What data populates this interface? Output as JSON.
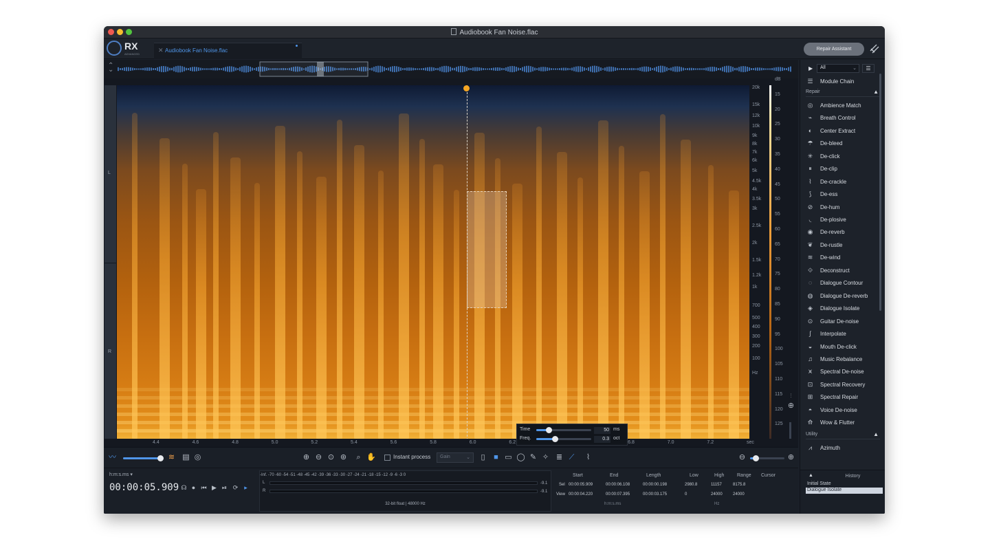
{
  "window": {
    "title": "Audiobook Fan Noise.flac"
  },
  "app": {
    "logo_text": "RX",
    "logo_sub": "ADVANCED"
  },
  "tab": {
    "name": "Audiobook Fan Noise.flac"
  },
  "header": {
    "repair_assistant": "Repair Assistant"
  },
  "spectrogram": {
    "channel_labels": [
      "L",
      "R"
    ],
    "freq_labels": [
      "20k",
      "15k",
      "12k",
      "10k",
      "9k",
      "8k",
      "7k",
      "6k",
      "5k",
      "4.5k",
      "4k",
      "3.5k",
      "3k",
      "2.5k",
      "2k",
      "1.5k",
      "1.2k",
      "1k",
      "700",
      "500",
      "400",
      "300",
      "200",
      "100",
      "Hz"
    ],
    "db_labels": [
      "dB",
      "15",
      "20",
      "25",
      "30",
      "35",
      "40",
      "45",
      "50",
      "55",
      "60",
      "65",
      "70",
      "75",
      "80",
      "85",
      "90",
      "95",
      "100",
      "105",
      "110",
      "115",
      "120",
      "125"
    ],
    "time_labels": [
      "4.4",
      "4.6",
      "4.8",
      "5.0",
      "5.2",
      "5.4",
      "5.6",
      "5.8",
      "6.0",
      "6.2",
      "6.4",
      "6.6",
      "6.8",
      "7.0",
      "7.2",
      "sec"
    ]
  },
  "toolbar": {
    "instant_process": "Instant process",
    "gain_placeholder": "Gain"
  },
  "brush_popup": {
    "time_label": "Time",
    "time_value": "50",
    "time_unit": "ms",
    "freq_label": "Freq.",
    "freq_value": "0.3",
    "freq_unit": "oct"
  },
  "transport": {
    "format": "h:m:s.ms",
    "timecode": "00:00:05.909"
  },
  "meter": {
    "scale": "-Inf.   -70      -60      -54  -51  -48  -45  -42  -39  -36  -33  -30  -27  -24  -21  -18  -15  -12   -9   -6   -3    0",
    "channels": [
      "L",
      "R"
    ],
    "peaks": [
      "-9.1",
      "-9.1"
    ],
    "format": "32-bit float | 48000 Hz"
  },
  "selection": {
    "headers": {
      "start": "Start",
      "end": "End",
      "length": "Length",
      "low": "Low",
      "high": "High",
      "range": "Range",
      "cursor": "Cursor"
    },
    "sel_label": "Sel",
    "view_label": "View",
    "sel": {
      "start": "00:00:05.909",
      "end": "00:00:06.108",
      "length": "00:00:00.198",
      "low": "2980.8",
      "high": "11157",
      "range": "8175.8"
    },
    "view": {
      "start": "00:00:04.220",
      "end": "00:00:07.395",
      "length": "00:00:03.175",
      "low": "0",
      "high": "24000",
      "range": "24000"
    },
    "time_unit": "h:m:s.ms",
    "freq_unit": "Hz"
  },
  "sidebar": {
    "filter": "All",
    "module_chain": "Module Chain",
    "repair_section": "Repair",
    "repair_items": [
      "Ambience Match",
      "Breath Control",
      "Center Extract",
      "De-bleed",
      "De-click",
      "De-clip",
      "De-crackle",
      "De-ess",
      "De-hum",
      "De-plosive",
      "De-reverb",
      "De-rustle",
      "De-wind",
      "Deconstruct",
      "Dialogue Contour",
      "Dialogue De-reverb",
      "Dialogue Isolate",
      "Guitar De-noise",
      "Interpolate",
      "Mouth De-click",
      "Music Rebalance",
      "Spectral De-noise",
      "Spectral Recovery",
      "Spectral Repair",
      "Voice De-noise",
      "Wow & Flutter"
    ],
    "utility_section": "Utility",
    "utility_items": [
      "Azimuth"
    ]
  },
  "history": {
    "title": "History",
    "items": [
      "Initial State",
      "Dialogue Isolate"
    ],
    "selected": "Dialogue Isolate"
  },
  "colors": {
    "accent": "#4f95e8",
    "playhead": "#f5a623",
    "background": "#1b2029"
  }
}
